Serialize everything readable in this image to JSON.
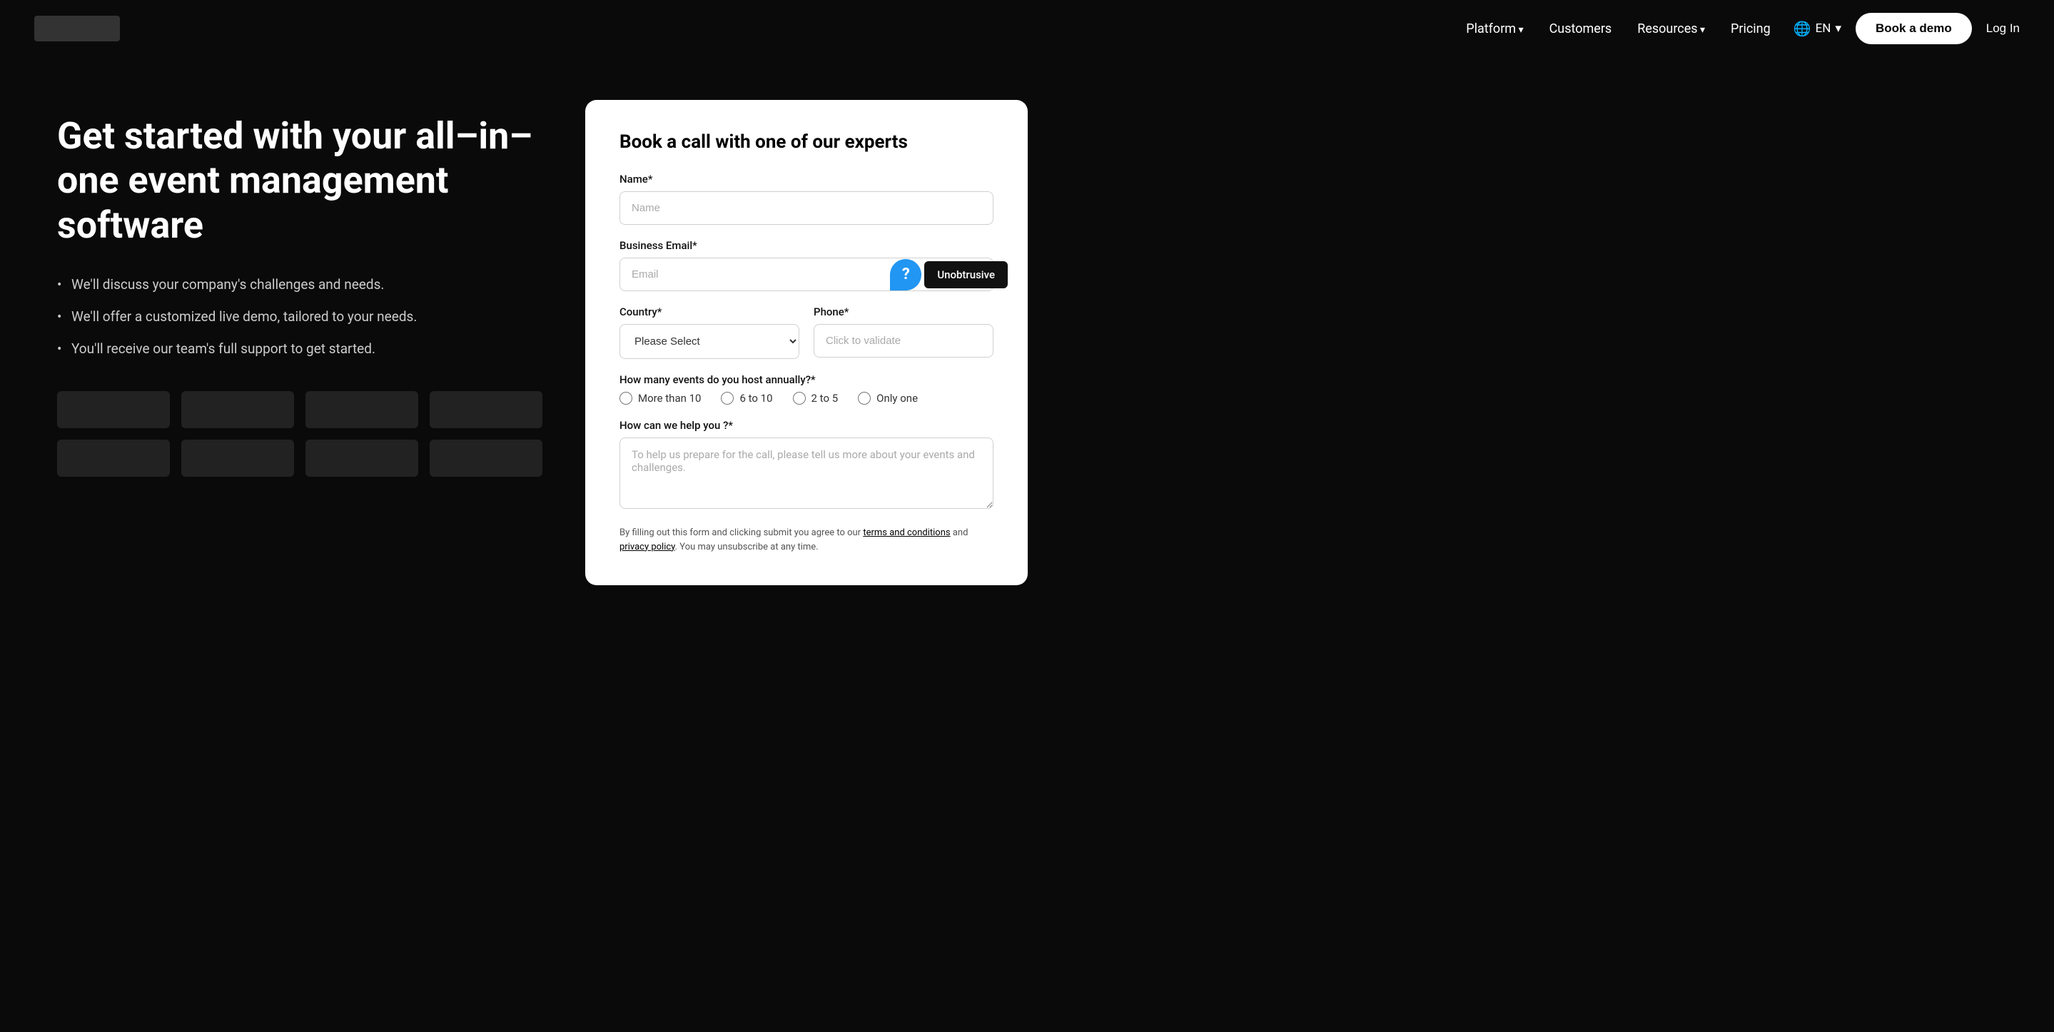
{
  "nav": {
    "logo_alt": "Logo",
    "links": [
      {
        "label": "Platform",
        "has_dropdown": true,
        "id": "platform"
      },
      {
        "label": "Customers",
        "has_dropdown": false,
        "id": "customers"
      },
      {
        "label": "Resources",
        "has_dropdown": true,
        "id": "resources"
      },
      {
        "label": "Pricing",
        "has_dropdown": false,
        "id": "pricing"
      }
    ],
    "lang_label": "EN",
    "book_demo_label": "Book a demo",
    "login_label": "Log In"
  },
  "hero": {
    "title": "Get started with your all–in–one event management software",
    "bullets": [
      "We'll discuss your company's challenges and needs.",
      "We'll offer a customized live demo, tailored to your needs.",
      "You'll receive our team's full support to get started."
    ]
  },
  "form": {
    "title": "Book a call with one of our experts",
    "name_label": "Name*",
    "name_placeholder": "Name",
    "email_label": "Business Email*",
    "email_placeholder": "Email",
    "country_label": "Country*",
    "country_default": "Please Select",
    "phone_label": "Phone*",
    "phone_placeholder": "Click to validate",
    "events_label": "How many events do you host annually?*",
    "events_options": [
      {
        "label": "More than 10",
        "value": "more_than_10"
      },
      {
        "label": "6 to 10",
        "value": "6_to_10"
      },
      {
        "label": "2 to 5",
        "value": "2_to_5"
      },
      {
        "label": "Only one",
        "value": "only_one"
      }
    ],
    "help_label": "How can we help you ?*",
    "help_placeholder": "To help us prepare for the call, please tell us more about your events and challenges.",
    "privacy_text_1": "By filling out this form and clicking submit you agree to our ",
    "privacy_link_1": "terms and conditions",
    "privacy_text_2": " and ",
    "privacy_link_2": "privacy policy",
    "privacy_text_3": ". You may unsubscribe at any time.",
    "tooltip_label": "Unobtrusive"
  }
}
